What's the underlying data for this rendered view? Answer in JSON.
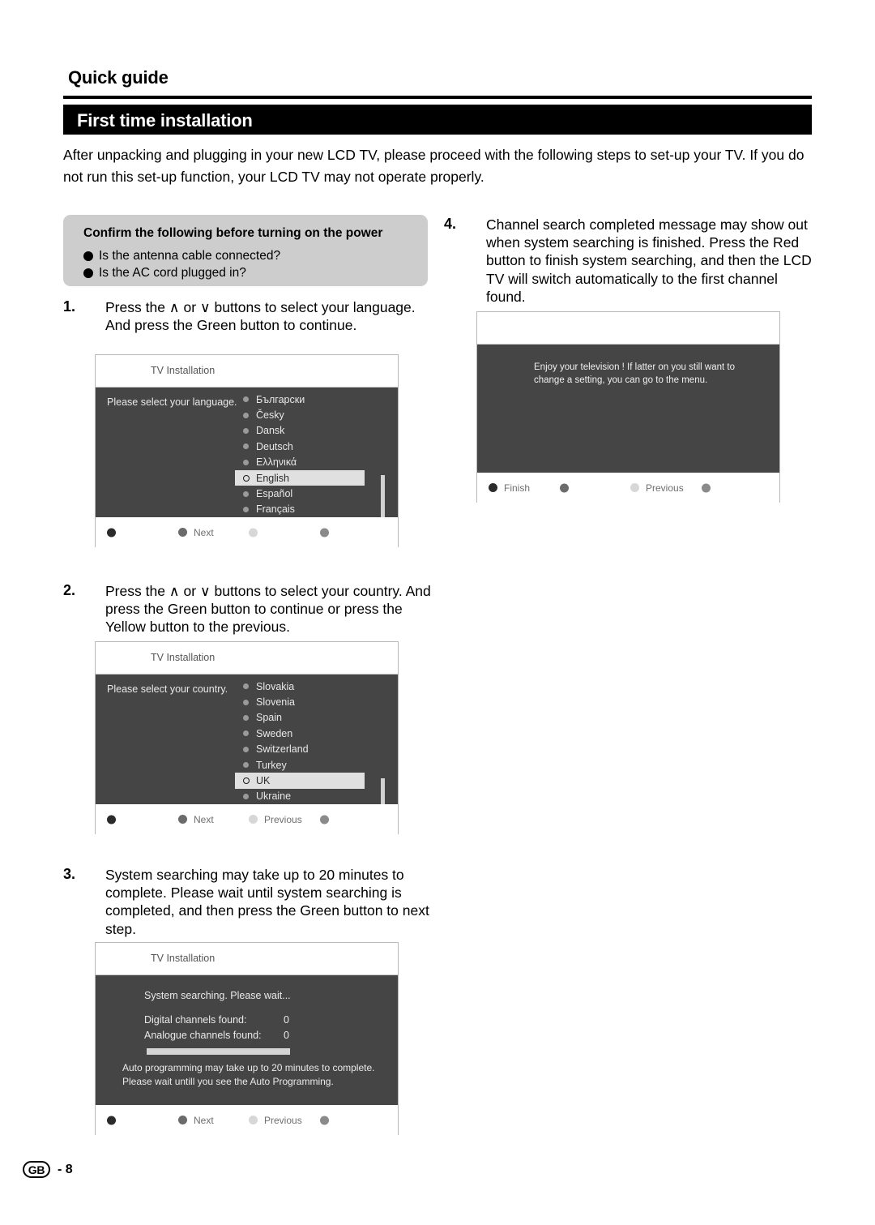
{
  "header": {
    "quick_guide": "Quick guide",
    "section_title": "First time installation",
    "intro": "After unpacking and plugging in your new LCD TV, please proceed with the following steps to set-up your TV. If you do not run this set-up function, your LCD TV may not operate properly."
  },
  "confirm_box": {
    "title": "Confirm the following  before turning on the power",
    "items": [
      "Is the antenna cable connected?",
      "Is the AC cord plugged in?"
    ]
  },
  "steps": [
    {
      "number": "1.",
      "text": "Press the ∧ or ∨ buttons to select your language. And press the Green button to continue."
    },
    {
      "number": "2.",
      "text": "Press the ∧ or ∨ buttons to select your country. And press the Green button to continue or press the Yellow button to the previous."
    },
    {
      "number": "3.",
      "text": "System searching may take up to 20 minutes to complete. Please wait until system searching is completed, and then press the Green button to next step."
    },
    {
      "number": "4.",
      "text": "Channel search completed message may show out when system searching is finished. Press the Red button to finish system searching, and then the LCD TV will switch automatically to the first channel found."
    }
  ],
  "screens": {
    "language": {
      "header_title": "TV Installation",
      "prompt": "Please select your language.",
      "options": [
        {
          "label": "Български",
          "selected": false
        },
        {
          "label": "Česky",
          "selected": false
        },
        {
          "label": "Dansk",
          "selected": false
        },
        {
          "label": "Deutsch",
          "selected": false
        },
        {
          "label": "Ελληνικά",
          "selected": false
        },
        {
          "label": "English",
          "selected": true
        },
        {
          "label": "Español",
          "selected": false
        },
        {
          "label": "Français",
          "selected": false
        }
      ],
      "footer": {
        "red": "",
        "green": "Next",
        "yellow": "",
        "blue": ""
      }
    },
    "country": {
      "header_title": "TV Installation",
      "prompt": "Please select your country.",
      "options": [
        {
          "label": "Slovakia",
          "selected": false
        },
        {
          "label": "Slovenia",
          "selected": false
        },
        {
          "label": "Spain",
          "selected": false
        },
        {
          "label": "Sweden",
          "selected": false
        },
        {
          "label": "Switzerland",
          "selected": false
        },
        {
          "label": "Turkey",
          "selected": false
        },
        {
          "label": "UK",
          "selected": true
        },
        {
          "label": "Ukraine",
          "selected": false
        }
      ],
      "footer": {
        "red": "",
        "green": "Next",
        "yellow": "Previous",
        "blue": ""
      }
    },
    "searching": {
      "header_title": "TV Installation",
      "status": "System searching. Please wait...",
      "stats": [
        {
          "label": "Digital channels found:",
          "value": "0"
        },
        {
          "label": "Analogue channels found:",
          "value": "0"
        }
      ],
      "note_line1": "Auto programming may take up to 20 minutes to complete.",
      "note_line2": "Please wait untill you see the Auto Programming.",
      "footer": {
        "red": "",
        "green": "Next",
        "yellow": "Previous",
        "blue": ""
      }
    },
    "completed": {
      "header_title": "",
      "message": "Enjoy your television ! If latter on you still want to change a setting, you can go to the menu.",
      "footer": {
        "red": "Finish",
        "green": "",
        "yellow": "Previous",
        "blue": ""
      }
    }
  },
  "footer": {
    "region_code": "GB",
    "page_label": "- 8"
  }
}
